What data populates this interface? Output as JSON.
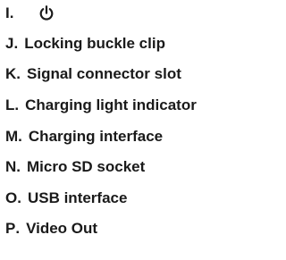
{
  "items": [
    {
      "letter": "I",
      "sep": ".",
      "label": "",
      "icon": "power-icon"
    },
    {
      "letter": "J",
      "sep": ".",
      "label": "Locking buckle clip"
    },
    {
      "letter": "K",
      "sep": ".",
      "label": "Signal connector slot"
    },
    {
      "letter": "L",
      "sep": ".",
      "label": "Charging light indicator"
    },
    {
      "letter": "M",
      "sep": ".",
      "label": "Charging interface"
    },
    {
      "letter": "N",
      "sep": ".",
      "label": "Micro SD socket"
    },
    {
      "letter": "O",
      "sep": ".",
      "label": "USB interface"
    },
    {
      "letter": "P",
      "sep": ".",
      "label": "Video Out"
    }
  ]
}
